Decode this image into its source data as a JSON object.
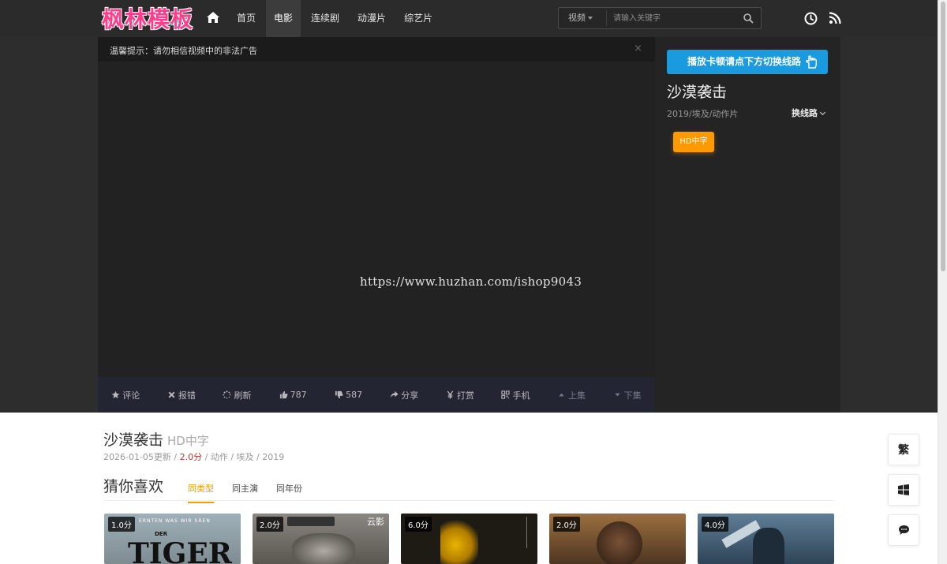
{
  "header": {
    "logo": "枫林模板",
    "nav": [
      "首页",
      "电影",
      "连续剧",
      "动漫片",
      "综艺片"
    ],
    "nav_active": 1,
    "search_type": "视频",
    "search_placeholder": "请输入关键字"
  },
  "player": {
    "notice": "温馨提示：请勿相信视频中的非法广告",
    "close": "×",
    "watermark": "https://www.huzhan.com/ishop9043",
    "tools": [
      {
        "icon": "star-icon",
        "label": "评论"
      },
      {
        "icon": "close-icon",
        "label": "报错"
      },
      {
        "icon": "refresh-icon",
        "label": "刷新"
      },
      {
        "icon": "thumbs-up-icon",
        "label": "787"
      },
      {
        "icon": "thumbs-down-icon",
        "label": "587"
      },
      {
        "icon": "share-icon",
        "label": "分享"
      },
      {
        "icon": "yen-icon",
        "label": "打赏"
      },
      {
        "icon": "qrcode-icon",
        "label": "手机"
      },
      {
        "icon": "caret-up-icon",
        "label": "上集"
      },
      {
        "icon": "caret-down-icon",
        "label": "下集"
      }
    ]
  },
  "side": {
    "switch_text": "播放卡顿请点下方切换线路",
    "title": "沙漠袭击",
    "meta": "2019/埃及/动作片",
    "line_switch": "换线路",
    "episode": "HD中字"
  },
  "info": {
    "title": "沙漠袭击",
    "quality": "HD中字",
    "date": "2026-01-05更新",
    "score": "2.0分",
    "genre": "动作",
    "region": "埃及",
    "year": "2019"
  },
  "recommend": {
    "title": "猜你喜欢",
    "tabs": [
      "同类型",
      "同主演",
      "同年份"
    ],
    "active_tab": 0,
    "posters": [
      {
        "score": "1.0分",
        "text_top": "ERNTEN WAS WIR SÄEN",
        "text_small": "DER",
        "text_big": "TIGER",
        "bg": "#8a9aa3"
      },
      {
        "score": "2.0分",
        "text_top": "云影",
        "text_small": "",
        "text_big": "",
        "bg": "#6d6a64"
      },
      {
        "score": "6.0分",
        "text_top": "",
        "text_small": "",
        "text_big": "",
        "bg": "#1e1b14"
      },
      {
        "score": "2.0分",
        "text_top": "",
        "text_small": "",
        "text_big": "",
        "bg": "#7a5a3a"
      },
      {
        "score": "4.0分",
        "text_top": "",
        "text_small": "",
        "text_big": "",
        "bg": "#4a6a85"
      }
    ]
  },
  "float_buttons": [
    {
      "icon": "traditional-chinese-icon",
      "label": "繁"
    },
    {
      "icon": "windows-icon",
      "label": ""
    },
    {
      "icon": "comment-icon",
      "label": ""
    }
  ]
}
